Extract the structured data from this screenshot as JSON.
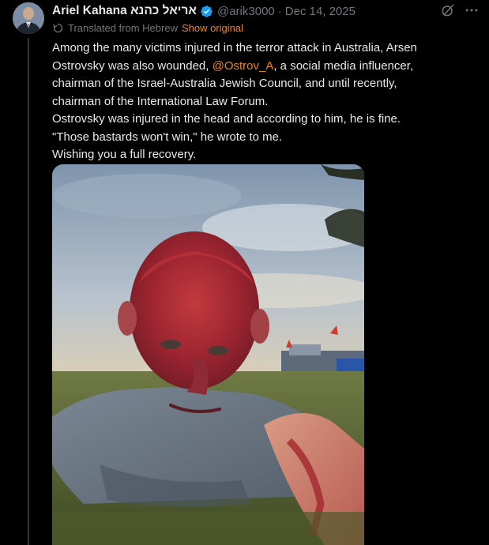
{
  "author": {
    "display_name": "Ariel Kahana אריאל כהנא",
    "handle": "@arik3000",
    "separator": "·",
    "date": "Dec 14, 2025",
    "avatar": "avatar-photo",
    "verified_icon": "verified-badge-icon"
  },
  "translation": {
    "icon": "translate-icon",
    "label": "Translated from Hebrew",
    "action": "Show original"
  },
  "header_actions": {
    "grok_icon": "grok-icon",
    "more_icon": "more-icon"
  },
  "tweet": {
    "line1": "Among the many victims injured in the terror attack in Australia, Arsen",
    "line2_pre": "Ostrovsky was also wounded, ",
    "mention": "@Ostrov_A",
    "line2_post": ", a social media influencer,",
    "line3": "chairman of the Israel-Australia Jewish Council, and until recently,",
    "line4": "chairman of the International Law Forum.",
    "line5": "Ostrovsky was injured in the head and according to him, he is fine.",
    "line6": "\"Those bastards won't win,\" he wrote to me.",
    "line7": "Wishing you a full recovery."
  },
  "colors": {
    "background": "#000000",
    "text": "#e7e9ea",
    "secondary_text": "#71767b",
    "link_accent": "#e8832c",
    "verified_blue": "#1d9bf0"
  },
  "media": {
    "kind": "photo"
  }
}
